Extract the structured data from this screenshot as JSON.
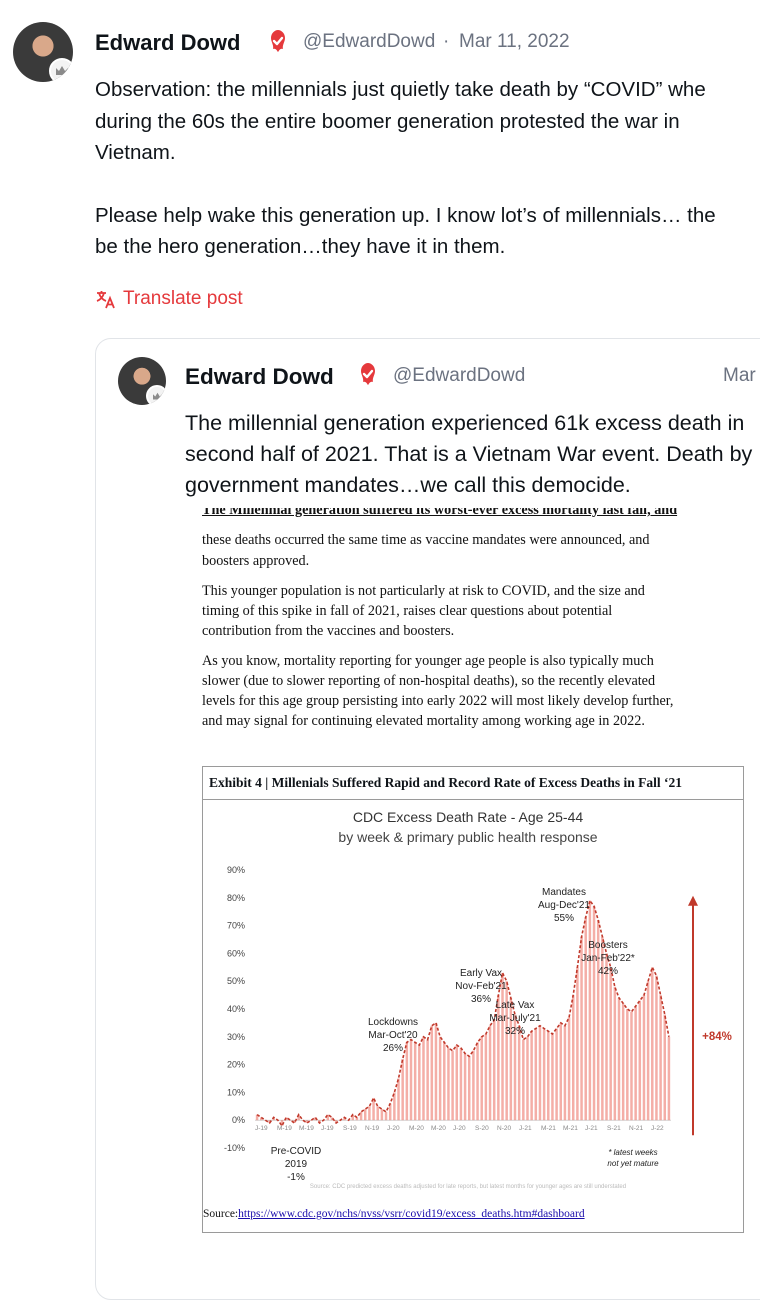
{
  "post": {
    "author": "Edward Dowd",
    "handle": "@EdwardDowd",
    "separator": "·",
    "date": "Mar 11, 2022",
    "lines": [
      "Observation: the millennials just quietly take death by “COVID” whe",
      "during the 60s the entire boomer generation protested the war in",
      "Vietnam.",
      "Please help wake this generation up. I know lot’s of millennials… the",
      "be the hero generation…they have it in them."
    ],
    "translate_label": "Translate post"
  },
  "quote": {
    "author": "Edward Dowd",
    "handle": "@EdwardDowd",
    "date": "Mar",
    "lines": [
      "The millennial generation experienced 61k excess death in",
      "second half of 2021. That is a Vietnam War event. Death by",
      "government mandates…we call this democide."
    ]
  },
  "document": {
    "para1": [
      "The Millennial generation suffered its worst-ever excess mortality last fall, and",
      "these deaths occurred the same time as vaccine mandates were announced, and",
      "boosters approved."
    ],
    "para2": [
      "This younger population is not particularly at risk to COVID, and the size and",
      "timing of this spike in fall of 2021, raises clear questions about potential",
      "contribution from the vaccines and boosters."
    ],
    "para3": [
      "As you know, mortality reporting for younger age people is also typically much",
      "slower (due to slower reporting of non-hospital deaths), so the recently elevated",
      "levels for this age group persisting into early 2022 will most likely develop further,",
      "and may signal for continuing elevated mortality among working age in 2022."
    ],
    "exhibit_title": "Exhibit 4 | Millenials Suffered Rapid and Record Rate of Excess Deaths in Fall ‘21",
    "source_label": "Source:",
    "source_url": "https://www.cdc.gov/nchs/nvss/vsrr/covid19/excess_deaths.htm#dashboard"
  },
  "chart_data": {
    "type": "bar",
    "title": "CDC Excess Death Rate - Age 25-44",
    "subtitle": "by week & primary public health response",
    "ylim": [
      -10,
      90
    ],
    "yticks": [
      "90%",
      "80%",
      "70%",
      "60%",
      "50%",
      "40%",
      "30%",
      "20%",
      "10%",
      "0%",
      "-10%"
    ],
    "xticks": [
      "J-19",
      "M-19",
      "M-19",
      "J-19",
      "S-19",
      "N-19",
      "J-20",
      "M-20",
      "M-20",
      "J-20",
      "S-20",
      "N-20",
      "J-21",
      "M-21",
      "M-21",
      "J-21",
      "S-21",
      "N-21",
      "J-22"
    ],
    "values": [
      2,
      1,
      0,
      -1,
      1,
      0,
      -2,
      1,
      0,
      -1,
      2,
      0,
      -1,
      0,
      1,
      -1,
      0,
      2,
      1,
      -1,
      0,
      1,
      0,
      2,
      1,
      3,
      4,
      5,
      8,
      5,
      4,
      3,
      6,
      10,
      15,
      22,
      28,
      29,
      28,
      27,
      30,
      29,
      34,
      35,
      30,
      28,
      26,
      25,
      27,
      26,
      24,
      23,
      25,
      28,
      30,
      31,
      34,
      36,
      45,
      53,
      50,
      44,
      38,
      34,
      29,
      30,
      32,
      33,
      34,
      33,
      32,
      31,
      33,
      35,
      34,
      37,
      45,
      55,
      66,
      73,
      79,
      77,
      72,
      66,
      60,
      55,
      48,
      44,
      42,
      40,
      39,
      41,
      43,
      45,
      50,
      55,
      52,
      45,
      38,
      30
    ],
    "annotations": [
      {
        "lines": [
          "Lockdowns",
          "Mar-Oct'20",
          "26%"
        ]
      },
      {
        "lines": [
          "Early Vax",
          "Nov-Feb'21",
          "36%"
        ]
      },
      {
        "lines": [
          "Late Vax",
          "Mar-July'21",
          "32%"
        ]
      },
      {
        "lines": [
          "Mandates",
          "Aug-Dec'21",
          "55%"
        ]
      },
      {
        "lines": [
          "Boosters",
          "Jan-Feb'22*",
          "42%"
        ]
      },
      {
        "lines": [
          "Pre-COVID",
          "2019",
          "-1%"
        ]
      }
    ],
    "change_label": "+84%",
    "footnote": [
      "* latest weeks",
      "not yet mature"
    ],
    "source_note": "Source: CDC predicted excess deaths adjusted for late reports, but latest months for younger ages are still understated",
    "colors": {
      "bar": "#e74c3c",
      "line": "#c0392b",
      "arrow": "#c0392b"
    }
  }
}
